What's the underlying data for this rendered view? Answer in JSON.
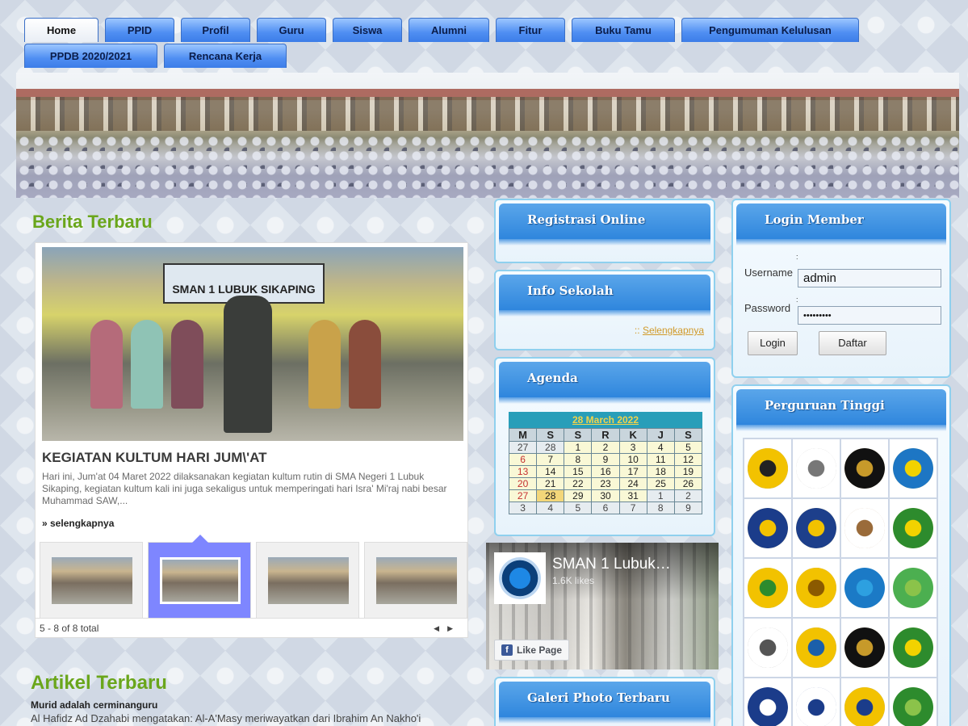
{
  "nav": {
    "row1": [
      "Home",
      "PPID",
      "Profil",
      "Guru",
      "Siswa",
      "Alumni",
      "Fitur",
      "Buku Tamu",
      "Pengumuman Kelulusan"
    ],
    "row2": [
      "PPDB 2020/2021",
      "Rencana Kerja"
    ]
  },
  "news": {
    "heading": "Berita Terbaru",
    "photo_sign": "SMAN 1 LUBUK SIKAPING",
    "title": "KEGIATAN KULTUM HARI JUM\\'AT",
    "text": "Hari ini, Jum'at 04 Maret 2022 dilaksanakan kegiatan kultum rutin di SMA Negeri 1 Lubuk Sikaping, kegiatan kultum kali ini juga sekaligus untuk memperingati hari Isra' Mi'raj nabi besar Muhammad SAW,...",
    "more": "» selengkapnya",
    "pager": "5 - 8 of 8 total"
  },
  "articles": {
    "heading": "Artikel Terbaru",
    "item_title": "Murid adalah cerminanguru",
    "item_text": "Al Hafidz Ad Dzahabi mengatakan: Al-A'Masy meriwayatkan dari Ibrahim An Nakho'i"
  },
  "registrasi": {
    "title": "Registrasi Online"
  },
  "info": {
    "title": "Info Sekolah",
    "prefix": ":: ",
    "link": "Selengkapnya"
  },
  "agenda": {
    "title": "Agenda",
    "month": "28 March 2022",
    "days": [
      "M",
      "S",
      "S",
      "R",
      "K",
      "J",
      "S"
    ],
    "weeks": [
      [
        "27",
        "28",
        "1",
        "2",
        "3",
        "4",
        "5"
      ],
      [
        "6",
        "7",
        "8",
        "9",
        "10",
        "11",
        "12"
      ],
      [
        "13",
        "14",
        "15",
        "16",
        "17",
        "18",
        "19"
      ],
      [
        "20",
        "21",
        "22",
        "23",
        "24",
        "25",
        "26"
      ],
      [
        "27",
        "28",
        "29",
        "30",
        "31",
        "1",
        "2"
      ],
      [
        "3",
        "4",
        "5",
        "6",
        "7",
        "8",
        "9"
      ]
    ]
  },
  "facebook": {
    "name": "SMAN 1 Lubuk…",
    "likes": "1.6K likes",
    "like_button": "Like Page"
  },
  "galeri": {
    "title": "Galeri Photo Terbaru"
  },
  "login": {
    "title": "Login Member",
    "username_label": "Username",
    "username_value": "admin",
    "password_label": "Password",
    "password_value": "•••••••••",
    "login_button": "Login",
    "register_button": "Daftar",
    "colon": ":"
  },
  "pt": {
    "title": "Perguruan Tinggi",
    "logos": [
      "ui-logo",
      "ugm-logo",
      "unand-logo",
      "unp-logo",
      "unj-logo",
      "unesa-logo",
      "upi-logo",
      "unri-logo",
      "unsyiah-logo",
      "unib-logo",
      "uin-logo",
      "iain-logo",
      "usu-logo",
      "unp-negeri-logo",
      "unnes-logo",
      "unand-2-logo",
      "ipb-logo",
      "its-logo",
      "unhas-logo",
      "unja-logo"
    ]
  },
  "colors": {
    "accent_green": "#6aa61b",
    "tab_blue": "#4f8ef2",
    "widget_blue": "#2f86dd",
    "link_gold": "#d19a29"
  }
}
